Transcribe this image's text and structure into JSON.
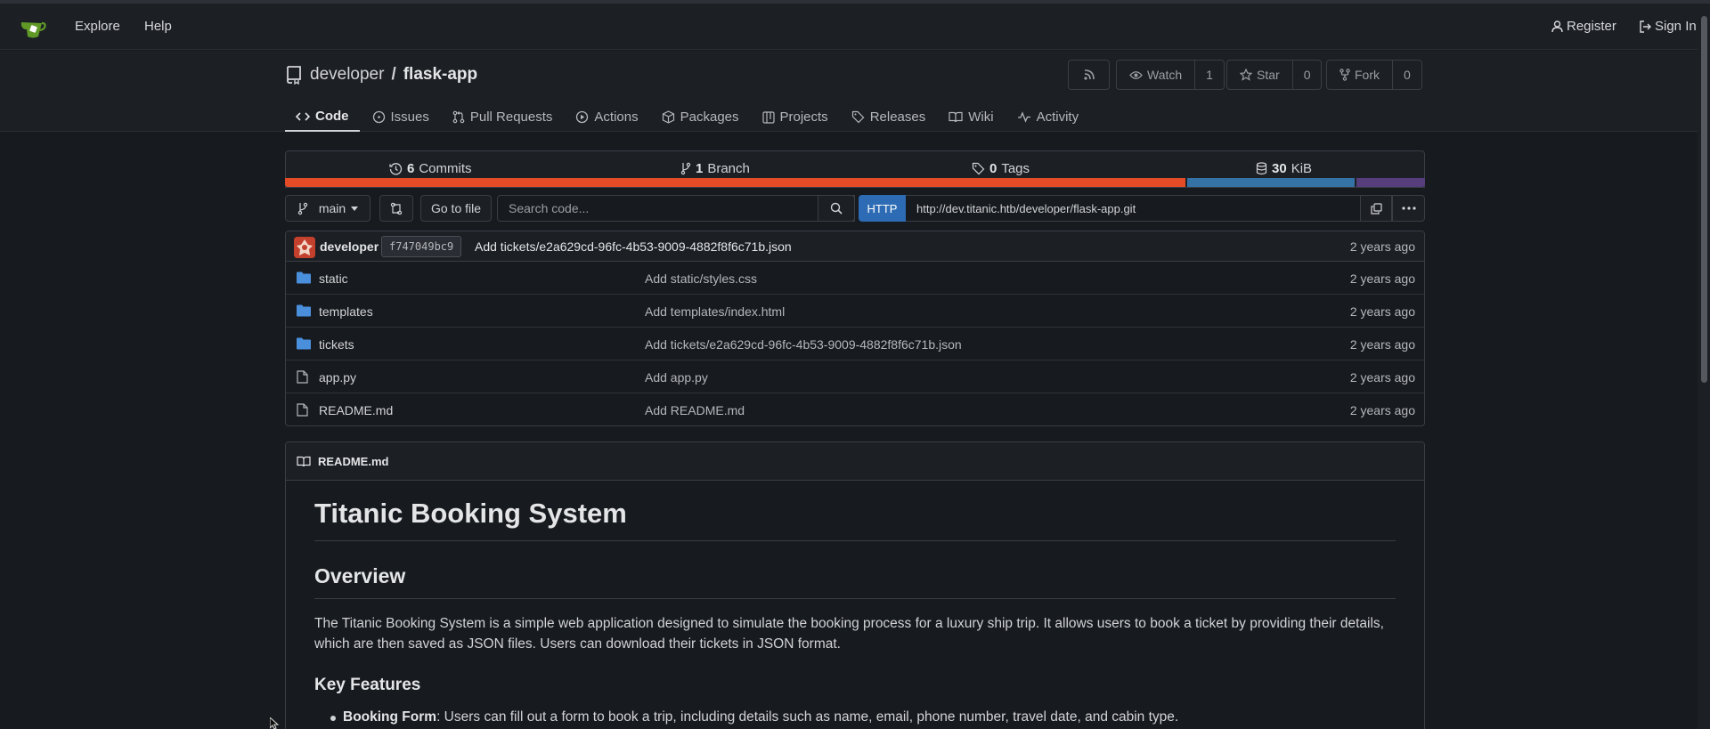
{
  "nav": {
    "explore": "Explore",
    "help": "Help",
    "register": "Register",
    "sign_in": "Sign In"
  },
  "repo": {
    "owner": "developer",
    "separator": "/",
    "name": "flask-app",
    "watch_label": "Watch",
    "watch_count": "1",
    "star_label": "Star",
    "star_count": "0",
    "fork_label": "Fork",
    "fork_count": "0"
  },
  "tabs": [
    {
      "label": "Code",
      "icon": "code-icon"
    },
    {
      "label": "Issues",
      "icon": "issue-icon"
    },
    {
      "label": "Pull Requests",
      "icon": "pull-request-icon"
    },
    {
      "label": "Actions",
      "icon": "play-icon"
    },
    {
      "label": "Packages",
      "icon": "package-icon"
    },
    {
      "label": "Projects",
      "icon": "project-icon"
    },
    {
      "label": "Releases",
      "icon": "tag-icon"
    },
    {
      "label": "Wiki",
      "icon": "book-icon"
    },
    {
      "label": "Activity",
      "icon": "pulse-icon"
    }
  ],
  "stats": {
    "commits_count": "6",
    "commits_label": "Commits",
    "branch_count": "1",
    "branch_label": "Branch",
    "tags_count": "0",
    "tags_label": "Tags",
    "size_count": "30",
    "size_unit": "KiB"
  },
  "languages": [
    {
      "color": "#e34c26",
      "share": 0.792
    },
    {
      "color": "#3572a5",
      "share": 0.148
    },
    {
      "color": "#563d7c",
      "share": 0.06
    }
  ],
  "toolbar": {
    "branch": "main",
    "go_to_file": "Go to file",
    "search_placeholder": "Search code...",
    "protocol": "HTTP",
    "clone_url": "http://dev.titanic.htb/developer/flask-app.git"
  },
  "latest_commit": {
    "author": "developer",
    "sha": "f747049bc9",
    "message": "Add tickets/e2a629cd-96fc-4b53-9009-4882f8f6c71b.json",
    "time": "2 years ago"
  },
  "files": [
    {
      "name": "static",
      "type": "folder",
      "message": "Add static/styles.css",
      "time": "2 years ago"
    },
    {
      "name": "templates",
      "type": "folder",
      "message": "Add templates/index.html",
      "time": "2 years ago"
    },
    {
      "name": "tickets",
      "type": "folder",
      "message": "Add tickets/e2a629cd-96fc-4b53-9009-4882f8f6c71b.json",
      "time": "2 years ago"
    },
    {
      "name": "app.py",
      "type": "file",
      "message": "Add app.py",
      "time": "2 years ago"
    },
    {
      "name": "README.md",
      "type": "file",
      "message": "Add README.md",
      "time": "2 years ago"
    }
  ],
  "readme": {
    "filename": "README.md",
    "h1": "Titanic Booking System",
    "h2_overview": "Overview",
    "overview_text": "The Titanic Booking System is a simple web application designed to simulate the booking process for a luxury ship trip. It allows users to book a ticket by providing their details, which are then saved as JSON files. Users can download their tickets in JSON format.",
    "h3_features": "Key Features",
    "features": [
      {
        "title": "Booking Form",
        "text": ": Users can fill out a form to book a trip, including details such as name, email, phone number, travel date, and cabin type."
      }
    ]
  },
  "colors": {
    "background": "#171a1e",
    "accent_blue": "#2d6cb5",
    "folder": "#4a8fdc"
  }
}
